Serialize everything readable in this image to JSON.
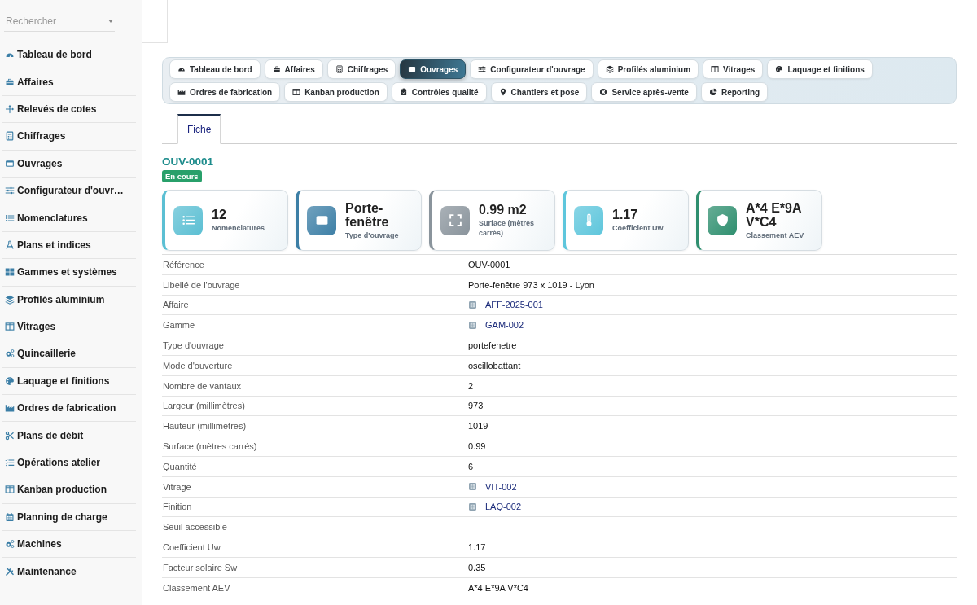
{
  "sidebar": {
    "search": {
      "placeholder": "Rechercher"
    },
    "items": [
      {
        "label": "Tableau de bord"
      },
      {
        "label": "Affaires"
      },
      {
        "label": "Relevés de cotes"
      },
      {
        "label": "Chiffrages"
      },
      {
        "label": "Ouvrages"
      },
      {
        "label": "Configurateur d'ouvr…"
      },
      {
        "label": "Nomenclatures"
      },
      {
        "label": "Plans et indices"
      },
      {
        "label": "Gammes et systèmes"
      },
      {
        "label": "Profilés aluminium"
      },
      {
        "label": "Vitrages"
      },
      {
        "label": "Quincaillerie"
      },
      {
        "label": "Laquage et finitions"
      },
      {
        "label": "Ordres de fabrication"
      },
      {
        "label": "Plans de débit"
      },
      {
        "label": "Opérations atelier"
      },
      {
        "label": "Kanban production"
      },
      {
        "label": "Planning de charge"
      },
      {
        "label": "Machines"
      },
      {
        "label": "Maintenance"
      }
    ]
  },
  "module_tabs": [
    {
      "label": "Tableau de bord",
      "selected": false
    },
    {
      "label": "Affaires",
      "selected": false
    },
    {
      "label": "Chiffrages",
      "selected": false
    },
    {
      "label": "Ouvrages",
      "selected": true
    },
    {
      "label": "Configurateur d'ouvrage",
      "selected": false
    },
    {
      "label": "Profilés aluminium",
      "selected": false
    },
    {
      "label": "Vitrages",
      "selected": false
    },
    {
      "label": "Laquage et finitions",
      "selected": false
    },
    {
      "label": "Ordres de fabrication",
      "selected": false
    },
    {
      "label": "Kanban production",
      "selected": false
    },
    {
      "label": "Contrôles qualité",
      "selected": false
    },
    {
      "label": "Chantiers et pose",
      "selected": false
    },
    {
      "label": "Service après-vente",
      "selected": false
    },
    {
      "label": "Reporting",
      "selected": false
    }
  ],
  "view_tabs": [
    {
      "label": "Fiche",
      "selected": true
    }
  ],
  "record": {
    "title": "OUV-0001",
    "status": "En cours"
  },
  "stats": [
    {
      "value": "12",
      "label": "Nomenclatures",
      "color": "#5bbfd3"
    },
    {
      "value": "Porte-fenêtre",
      "label": "Type d'ouvrage",
      "color": "#3d7fa6"
    },
    {
      "value": "0.99 m2",
      "label": "Surface (mètres carrés)",
      "color": "#8a949c"
    },
    {
      "value": "1.17",
      "label": "Coefficient Uw",
      "color": "#5ec6dc"
    },
    {
      "value": "A*4 E*9A V*C4",
      "label": "Classement AEV",
      "color": "#2f8f6f"
    }
  ],
  "fields": [
    {
      "label": "Référence",
      "value": "OUV-0001",
      "kind": "text"
    },
    {
      "label": "Libellé de l'ouvrage",
      "value": "Porte-fenêtre 973 x 1019 - Lyon",
      "kind": "text"
    },
    {
      "label": "Affaire",
      "value": "AFF-2025-001",
      "kind": "link"
    },
    {
      "label": "Gamme",
      "value": "GAM-002",
      "kind": "link"
    },
    {
      "label": "Type d'ouvrage",
      "value": "portefenetre",
      "kind": "text"
    },
    {
      "label": "Mode d'ouverture",
      "value": "oscillobattant",
      "kind": "text"
    },
    {
      "label": "Nombre de vantaux",
      "value": "2",
      "kind": "text"
    },
    {
      "label": "Largeur (millimètres)",
      "value": "973",
      "kind": "text"
    },
    {
      "label": "Hauteur (millimètres)",
      "value": "1019",
      "kind": "text"
    },
    {
      "label": "Surface (mètres carrés)",
      "value": "0.99",
      "kind": "text"
    },
    {
      "label": "Quantité",
      "value": "6",
      "kind": "text"
    },
    {
      "label": "Vitrage",
      "value": "VIT-002",
      "kind": "link"
    },
    {
      "label": "Finition",
      "value": "LAQ-002",
      "kind": "link"
    },
    {
      "label": "Seuil accessible",
      "value": "-",
      "kind": "empty"
    },
    {
      "label": "Coefficient Uw",
      "value": "1.17",
      "kind": "text"
    },
    {
      "label": "Facteur solaire Sw",
      "value": "0.35",
      "kind": "text"
    },
    {
      "label": "Classement AEV",
      "value": "A*4 E*9A V*C4",
      "kind": "text"
    }
  ]
}
